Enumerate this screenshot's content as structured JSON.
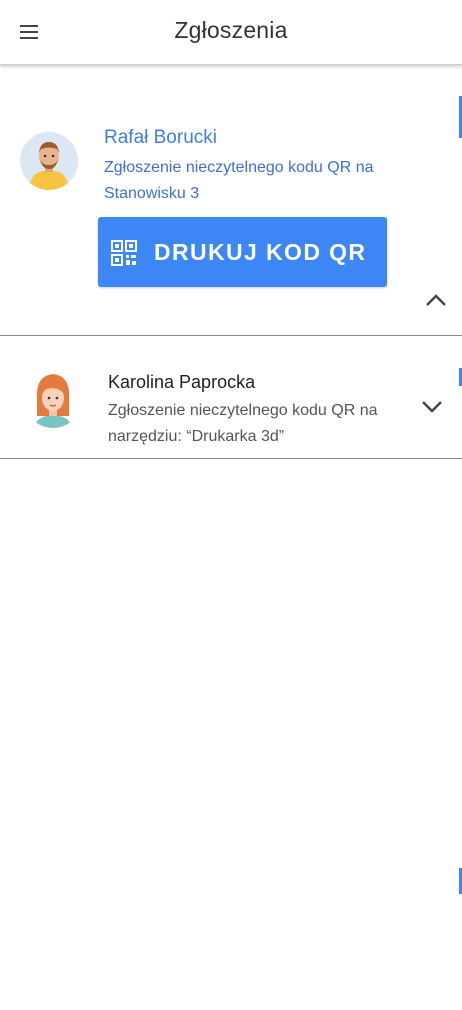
{
  "header": {
    "title": "Zgłoszenia",
    "menu_icon": "hamburger-menu-icon"
  },
  "reports": [
    {
      "name": "Rafał Borucki",
      "description": "Zgłoszenie nieczytelnego kodu QR na Stanowisku 3",
      "expanded": true,
      "avatar_icon": "man-avatar-icon",
      "action_label": "DRUKUJ KOD QR",
      "action_icon": "qr-code-icon",
      "toggle_icon": "chevron-up-icon"
    },
    {
      "name": "Karolina Paprocka",
      "description": "Zgłoszenie nieczytelnego kodu QR na narzędziu: “Drukarka 3d”",
      "expanded": false,
      "avatar_icon": "woman-avatar-icon",
      "toggle_icon": "chevron-down-icon"
    }
  ],
  "colors": {
    "accent": "#3d86f5",
    "active_text": "#3f7fe0",
    "primary_text": "#222222",
    "secondary_text": "#555555"
  }
}
